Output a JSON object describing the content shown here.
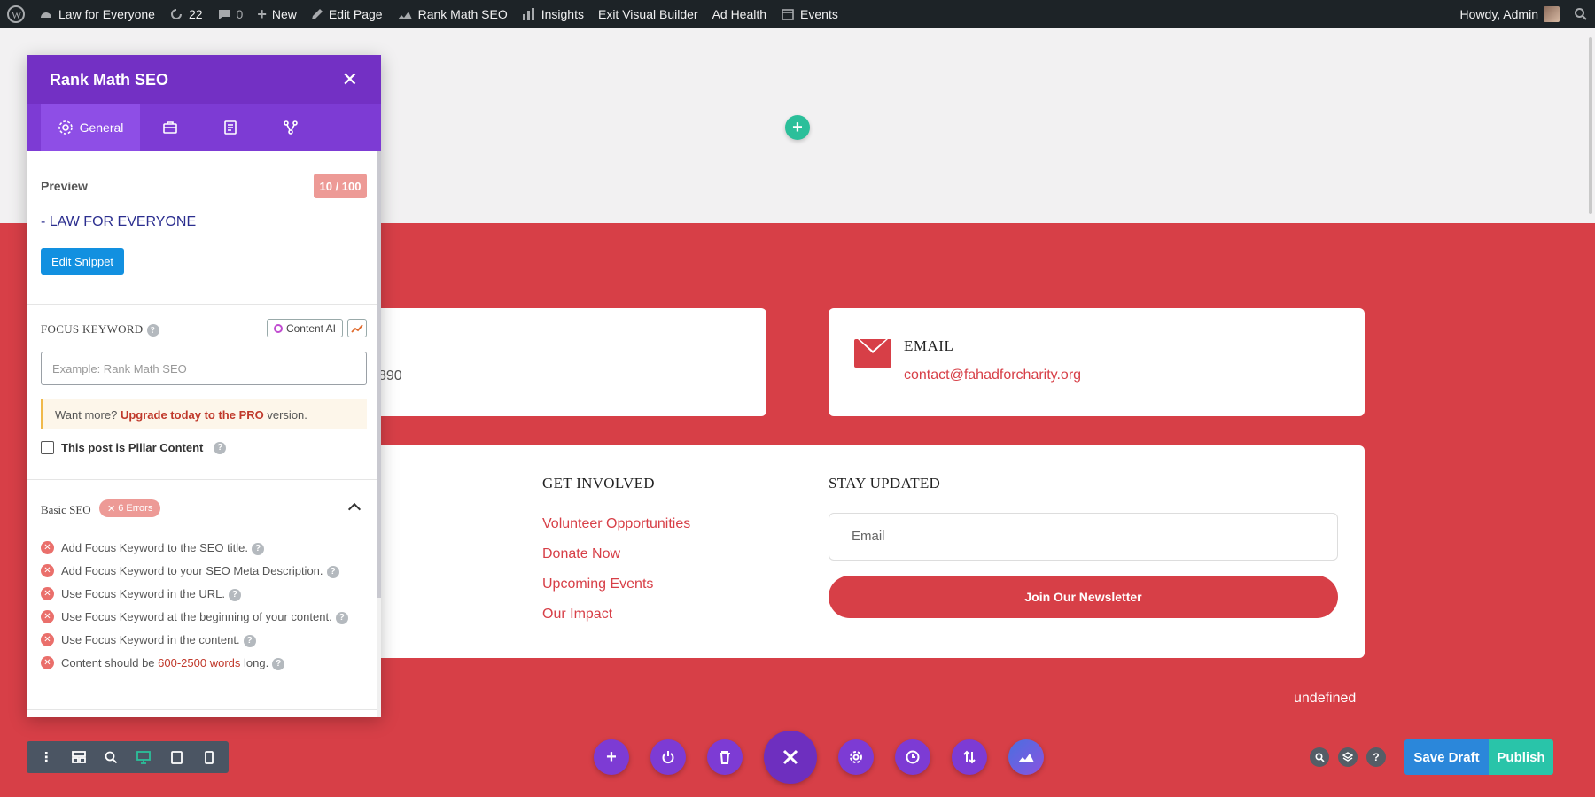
{
  "adminbar": {
    "site_name": "Law for Everyone",
    "updates_count": "22",
    "comments_count": "0",
    "new_label": "New",
    "edit_page_label": "Edit Page",
    "rankmath_label": "Rank Math SEO",
    "insights_label": "Insights",
    "exit_builder_label": "Exit Visual Builder",
    "ad_health_label": "Ad Health",
    "events_label": "Events",
    "howdy_label": "Howdy, Admin"
  },
  "page": {
    "phone_fragment": "890",
    "email_title": "EMAIL",
    "email_address": "contact@fahadforcharity.org",
    "get_involved": {
      "title": "GET INVOLVED",
      "links": [
        "Volunteer Opportunities",
        "Donate Now",
        "Upcoming Events",
        "Our Impact"
      ]
    },
    "stay_updated": {
      "title": "STAY UPDATED",
      "email_placeholder": "Email",
      "button_label": "Join Our Newsletter"
    },
    "footer_text": "undefined"
  },
  "rankmath": {
    "title": "Rank Math SEO",
    "close_glyph": "✕",
    "tab_general": "General",
    "preview_label": "Preview",
    "score": "10 / 100",
    "preview_title": "- LAW FOR EVERYONE",
    "edit_snippet_label": "Edit Snippet",
    "focus_keyword_label": "FOCUS KEYWORD",
    "content_ai_label": "Content AI",
    "keyword_placeholder": "Example: Rank Math SEO",
    "upgrade_prefix": "Want more?",
    "upgrade_link": "Upgrade today to the PRO",
    "upgrade_suffix": "version.",
    "pillar_label": "This post is Pillar Content",
    "basic_seo_label": "Basic SEO",
    "errors_badge": "6 Errors",
    "checks": [
      "Add Focus Keyword to the SEO title.",
      "Add Focus Keyword to your SEO Meta Description.",
      "Use Focus Keyword in the URL.",
      "Use Focus Keyword at the beginning of your content.",
      "Use Focus Keyword in the content."
    ],
    "check_length_prefix": "Content should be",
    "check_length_highlight": "600-2500 words",
    "check_length_suffix": "long."
  },
  "builder": {
    "save_draft_label": "Save Draft",
    "publish_label": "Publish"
  },
  "colors": {
    "brand_red": "#d73f47",
    "rankmath_purple": "#7330c4",
    "divi_teal": "#29c4a9",
    "save_blue": "#2b87da"
  }
}
